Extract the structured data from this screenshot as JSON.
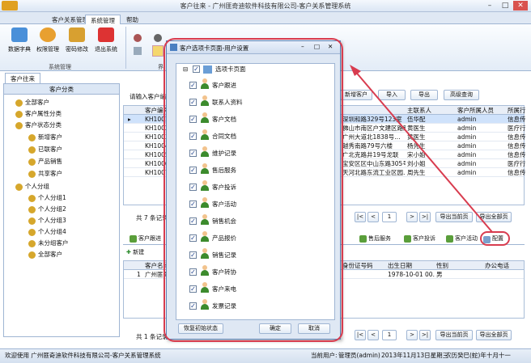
{
  "window": {
    "title": "客户往来 - 广州匪奇迪软件科技有限公司-客户关系管理系统",
    "buttons": [
      "–",
      "□",
      "✕"
    ]
  },
  "menu": {
    "tabs": [
      "客户关系管理",
      "系统管理",
      "帮助"
    ],
    "active": 1
  },
  "ribbon": {
    "buttons": [
      "数据字典",
      "权限管理",
      "密码修改",
      "退出系统"
    ],
    "group1_label": "系统管理",
    "group2_label": "界"
  },
  "left_panel": {
    "doc_tab": "客户往来",
    "header": "客户分类",
    "nodes": [
      "全部客户",
      "客户属性分类",
      "客户状态分类",
      "新增客户",
      "已联客户",
      "产品销售",
      "共享客户",
      "个人分组",
      "个人分组1",
      "个人分组2",
      "个人分组3",
      "个人分组4",
      "未分组客户",
      "全部客户"
    ]
  },
  "toolbar": {
    "search_label": "请输入客户编号",
    "buttons": [
      "新增客户",
      "导入",
      "导出",
      "高级查询"
    ]
  },
  "customer_grid": {
    "headers": [
      "客户编号",
      "…",
      "主联系人",
      "客户所属人员",
      "所属行"
    ],
    "rows": [
      [
        "KH1001",
        "深圳和路329号123室",
        "伍华配",
        "admin",
        "信息传"
      ],
      [
        "KH1002",
        "佛山市南区户文建区路路",
        "黄医生",
        "admin",
        "医疗行"
      ],
      [
        "KH1003",
        "广州大道北1838号…",
        "黄医生",
        "admin",
        "信息传"
      ],
      [
        "KH1004",
        "越秀南路79号六楼",
        "杨先生",
        "admin",
        "信息传"
      ],
      [
        "KH1005",
        "广北克路井19号龙联",
        "宋小姐",
        "admin",
        "信息传"
      ],
      [
        "KH1006",
        "宝安区区中山东路305号",
        "刘小姐",
        "admin",
        "医疗行"
      ],
      [
        "KH1007",
        "天河北路东流工业区园…",
        "周先生",
        "admin",
        "信息传"
      ]
    ],
    "footer": "共 7 条记录",
    "page": "1",
    "export_page": "导出当前页",
    "export_all": "导出全部页"
  },
  "detail_tabs": [
    "客户跟进",
    "…",
    "联系人资料",
    "售后服务",
    "客户投诉",
    "客户活动",
    "配置"
  ],
  "contact_grid": {
    "headers": [
      "客户名称",
      "身份证号码",
      "出生日期",
      "性别",
      "办公电话"
    ],
    "row": [
      "广州匪奇",
      "1978-10-01 00…",
      "男",
      ""
    ],
    "row_no": "1",
    "footer": "共 1 条记录",
    "page": "1",
    "export_page": "导出当前页",
    "export_all": "导出全部页",
    "new_btn": "新建"
  },
  "status": {
    "left": "欢迎使用 广州匪奇迪软件科技有限公司-客户关系管理系统",
    "current_user_label": "当前用户:",
    "user": "管理员(admin)",
    "date": "2013年11月13日星期三",
    "lunar": "农历癸巳(蛇)年十月十一"
  },
  "dialog": {
    "title": "客户选项卡页面-用户设置",
    "root": "选项卡页面",
    "items": [
      "客户跟进",
      "联系人资料",
      "客户文档",
      "合同文档",
      "维护记录",
      "售后服务",
      "客户投诉",
      "客户活动",
      "销售机会",
      "产品报价",
      "销售记录",
      "客户转协",
      "客户来电",
      "发票记录"
    ],
    "btn_reset": "恢复初始状态",
    "btn_ok": "确定",
    "btn_cancel": "取消"
  },
  "colors": {
    "accent": "#d83c4f",
    "ribbon": "#e3ecf7",
    "grid_header": "#e8eef7"
  }
}
